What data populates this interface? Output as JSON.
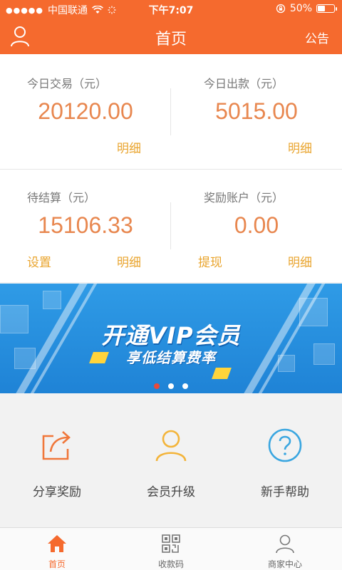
{
  "status_bar": {
    "carrier": "中国联通",
    "time": "下午7:07",
    "battery": "50%",
    "battery_level": 0.5
  },
  "header": {
    "title": "首页",
    "notice_label": "公告",
    "user_icon": "user-icon"
  },
  "stats": {
    "today_trade": {
      "label": "今日交易（元）",
      "value": "20120.00",
      "detail_link": "明细"
    },
    "today_payout": {
      "label": "今日出款（元）",
      "value": "5015.00",
      "detail_link": "明细"
    },
    "pending": {
      "label": "待结算（元）",
      "value": "15106.33",
      "settings_link": "设置",
      "detail_link": "明细"
    },
    "reward": {
      "label": "奖励账户（元）",
      "value": "0.00",
      "withdraw_link": "提现",
      "detail_link": "明细"
    }
  },
  "banner": {
    "title": "开通VIP会员",
    "subtitle": "享低结算费率",
    "slide_count": 3,
    "active_slide": 0
  },
  "features": [
    {
      "label": "分享奖励",
      "icon": "share-icon",
      "color": "#f0773a"
    },
    {
      "label": "会员升级",
      "icon": "member-icon",
      "color": "#f3b43a"
    },
    {
      "label": "新手帮助",
      "icon": "help-icon",
      "color": "#3aa6e0"
    }
  ],
  "tabbar": [
    {
      "label": "首页",
      "icon": "home-icon",
      "active": true
    },
    {
      "label": "收款码",
      "icon": "qrcode-icon",
      "active": false
    },
    {
      "label": "商家中心",
      "icon": "merchant-icon",
      "active": false
    }
  ],
  "colors": {
    "brand": "#f56a2e",
    "value_text": "#e8874f",
    "link_text": "#e9a42d"
  }
}
